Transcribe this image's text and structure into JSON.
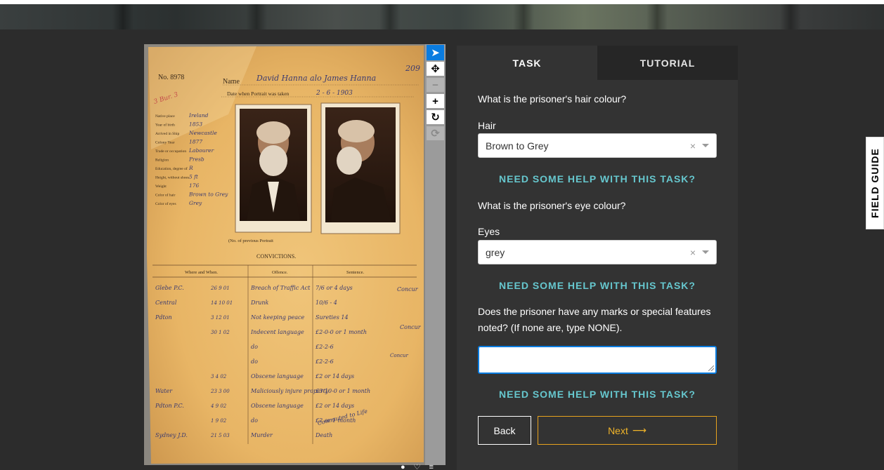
{
  "toolbar": {
    "tools": [
      {
        "name": "pointer",
        "glyph": "➤"
      },
      {
        "name": "move",
        "glyph": "✥"
      },
      {
        "name": "zoom-out",
        "glyph": "−"
      },
      {
        "name": "zoom-in",
        "glyph": "+"
      },
      {
        "name": "rotate",
        "glyph": "↻"
      },
      {
        "name": "reset",
        "glyph": "⟳"
      }
    ]
  },
  "document": {
    "number": "No. 8978",
    "name_label": "Name",
    "name_value": "David Hanna alo James Hanna",
    "page_no": "209",
    "date_label": "Date when Portrait was taken",
    "date_value": "2 - 6 - 1903",
    "convictions_heading": "CONVICTIONS.",
    "col_where": "Where and When.",
    "col_offence": "Offence.",
    "col_sentence": "Sentence.",
    "previous_portrait": "(No. of previous Portrait",
    "details": [
      {
        "label": "Native place",
        "value": "Ireland"
      },
      {
        "label": "Year of birth",
        "value": "1853"
      },
      {
        "label": "Arrived in Ship",
        "value": "Newcastle"
      },
      {
        "label": "Colony Year",
        "value": "1877"
      },
      {
        "label": "Trade or occupation",
        "value": "Labourer"
      },
      {
        "label": "Religion",
        "value": "Presb"
      },
      {
        "label": "Education, degree of",
        "value": "R"
      },
      {
        "label": "Height, without shoes",
        "value": "5 ft"
      },
      {
        "label": "Weight",
        "value": "176"
      },
      {
        "label": "Color of hair",
        "value": "Brown to Grey"
      },
      {
        "label": "Color of eyes",
        "value": "Grey"
      }
    ],
    "convictions": [
      {
        "where": "Glebe P.C.",
        "date": "26 9 01",
        "offence": "Breach of Traffic Act",
        "sentence": "7/6 or 4 days"
      },
      {
        "where": "Central",
        "date": "14 10 01",
        "offence": "Drunk",
        "sentence": "10/6 - 4"
      },
      {
        "where": "Pdton",
        "date": "3 12 01",
        "offence": "Not keeping peace",
        "sentence": "Sureties 14"
      },
      {
        "where": "",
        "date": "30 1 02",
        "offence": "Indecent language",
        "sentence": "£2-0-0 or 1 month"
      },
      {
        "where": "",
        "date": "",
        "offence": "do",
        "sentence": "£2-2-6"
      },
      {
        "where": "",
        "date": "",
        "offence": "do",
        "sentence": "£2-2-6"
      },
      {
        "where": "",
        "date": "3 4 02",
        "offence": "Obscene language",
        "sentence": "£2 or 14 days"
      },
      {
        "where": "Water",
        "date": "23 3 00",
        "offence": "Maliciously injure property",
        "sentence": "£3-10-0 or 1 month"
      },
      {
        "where": "Pdton P.C.",
        "date": "4 9 02",
        "offence": "Obscene language",
        "sentence": "£2 or 14 days"
      },
      {
        "where": "",
        "date": "1 9 02",
        "offence": "do",
        "sentence": "£2 or 1 month"
      },
      {
        "where": "Sydney J.D.",
        "date": "21 5 03",
        "offence": "Murder",
        "sentence": "Death"
      }
    ],
    "bracket_notes": [
      "Concur",
      "Concur",
      "Concur"
    ],
    "commuted": "Commuted to Life"
  },
  "tabs": {
    "task": "TASK",
    "tutorial": "TUTORIAL"
  },
  "task": {
    "q1": "What is the prisoner's hair colour?",
    "hair_label": "Hair",
    "hair_value": "Brown to Grey",
    "help1": "NEED SOME HELP WITH THIS TASK?",
    "q2": "What is the prisoner's eye colour?",
    "eyes_label": "Eyes",
    "eyes_value": "grey",
    "help2": "NEED SOME HELP WITH THIS TASK?",
    "q3": "Does the prisoner have any marks or special features noted? (If none are, type NONE).",
    "marks_value": "",
    "help3": "NEED SOME HELP WITH THIS TASK?",
    "clear_glyph": "×"
  },
  "nav": {
    "back": "Back",
    "next": "Next",
    "next_arrow": "⟶"
  },
  "field_guide": "FIELD GUIDE",
  "colors": {
    "accent_blue": "#0a7ce0",
    "help_teal": "#66c7ce",
    "next_gold": "#f0b429",
    "panel_bg": "#333333",
    "page_bg": "#2c2c2c"
  }
}
